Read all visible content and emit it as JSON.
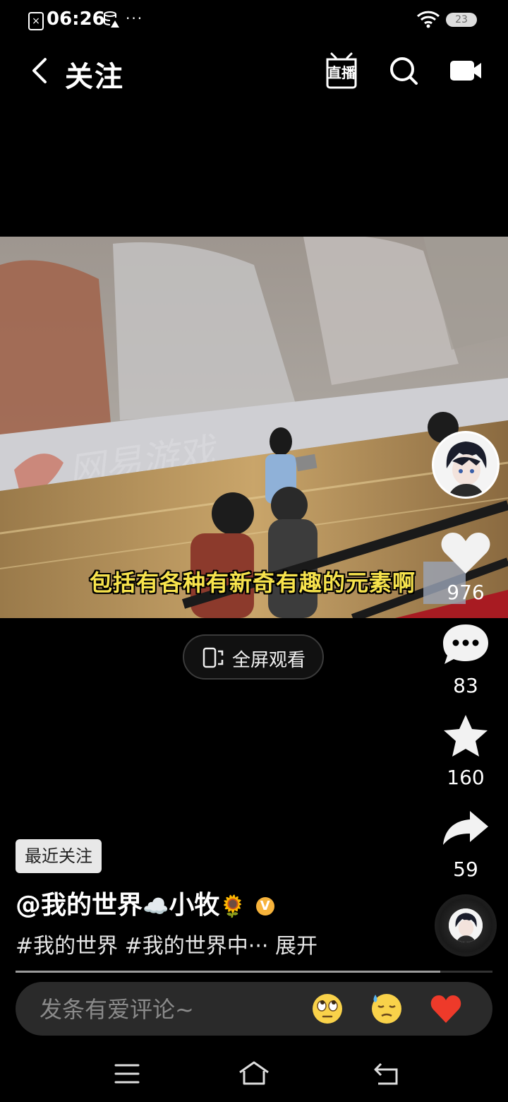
{
  "status_bar": {
    "time": "06:26",
    "more": "···",
    "battery": "23"
  },
  "header": {
    "title": "关注",
    "live_label": "直播"
  },
  "video": {
    "subtitle": "包括有各种有新奇有趣的元素啊"
  },
  "fullscreen_button": {
    "label": "全屏观看"
  },
  "actions": {
    "like_count": "976",
    "comment_count": "83",
    "favorite_count": "160",
    "share_count": "59"
  },
  "post": {
    "tag": "最近关注",
    "author_name_1": "@我的世界",
    "author_emoji_1": "☁️",
    "author_name_2": "小牧",
    "author_emoji_2": "🌻",
    "verified_mark": "V",
    "description": "#我的世界 #我的世界中··· 展开"
  },
  "progress": {
    "fraction": 0.89
  },
  "comment_bar": {
    "placeholder": "发条有爱评论~",
    "emoji_1": "🙄",
    "emoji_2": "😓",
    "emoji_3": "❤️"
  },
  "colors": {
    "subtitle": "#f7e34c",
    "verified": "#f7b33b",
    "background": "#000000"
  }
}
